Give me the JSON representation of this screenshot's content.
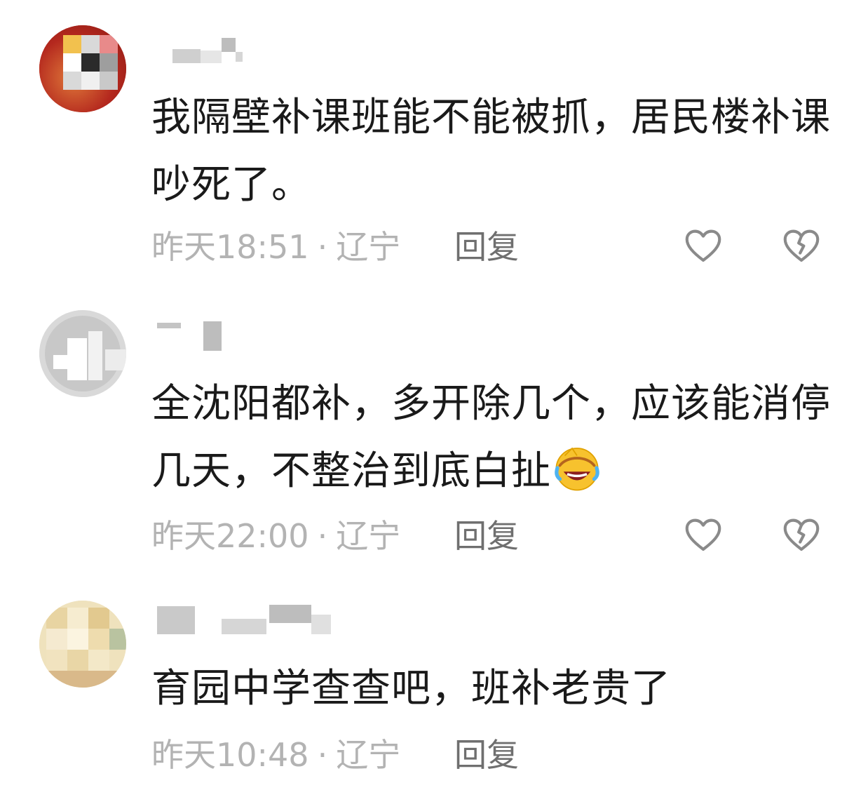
{
  "comments": [
    {
      "text": "我隔壁补课班能不能被抓，居民楼补课吵死了。",
      "time": "昨天18:51",
      "location": "辽宁",
      "reply_label": "回复",
      "has_emoji": false
    },
    {
      "text": "全沈阳都补，多开除几个，应该能消停几天，不整治到底白扯",
      "time": "昨天22:00",
      "location": "辽宁",
      "reply_label": "回复",
      "has_emoji": true,
      "emoji": "rolling-laughing-emoji"
    },
    {
      "text": "育园中学查查吧，班补老贵了",
      "time": "昨天10:48",
      "location": "辽宁",
      "reply_label": "回复",
      "has_emoji": false
    }
  ],
  "meta_separator": "·",
  "icons": {
    "like": "heart-outline-icon",
    "dislike": "broken-heart-icon"
  },
  "colors": {
    "text": "#1a1a1a",
    "meta": "#b3b3b3",
    "reply": "#6f6f6f",
    "icon": "#8a8a8a"
  }
}
